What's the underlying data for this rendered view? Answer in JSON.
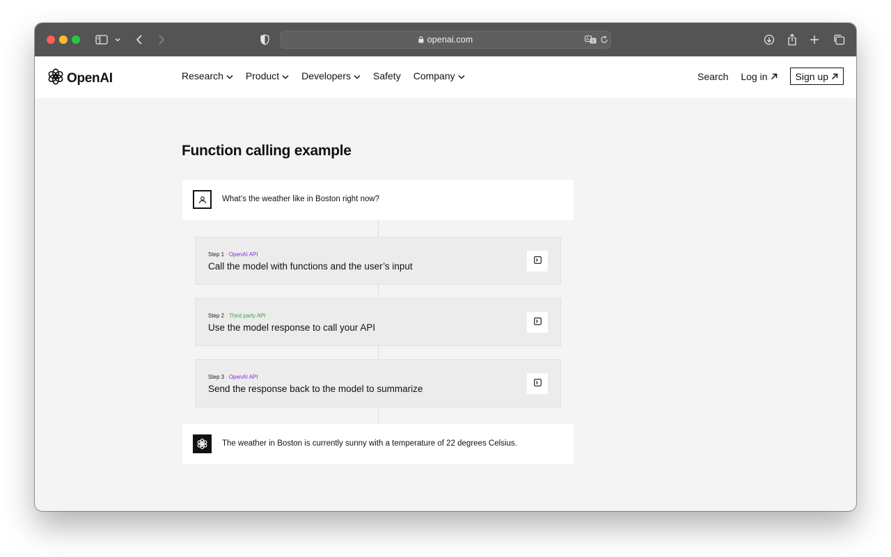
{
  "browser": {
    "url": "openai.com"
  },
  "header": {
    "logo_text": "OpenAI",
    "nav": [
      {
        "label": "Research",
        "has_dropdown": true
      },
      {
        "label": "Product",
        "has_dropdown": true
      },
      {
        "label": "Developers",
        "has_dropdown": true
      },
      {
        "label": "Safety",
        "has_dropdown": false
      },
      {
        "label": "Company",
        "has_dropdown": true
      }
    ],
    "search_label": "Search",
    "login_label": "Log in",
    "signup_label": "Sign up"
  },
  "main": {
    "title": "Function calling example",
    "user_message": "What’s the weather like in Boston right now?",
    "steps": [
      {
        "step_label": "Step 1",
        "api_label": "OpenAI API",
        "api_type": "openai",
        "title": "Call the model with functions and the user’s input"
      },
      {
        "step_label": "Step 2",
        "api_label": "Third party API",
        "api_type": "third",
        "title": "Use the model response to call your API"
      },
      {
        "step_label": "Step 3",
        "api_label": "OpenAI API",
        "api_type": "openai",
        "title": "Send the response back to the model to summarize"
      }
    ],
    "assistant_message": "The weather in Boston is currently sunny with a temperature of 22 degrees Celsius."
  },
  "colors": {
    "openai_api": "#8a2be2",
    "third_party_api": "#3aa53a",
    "toolbar": "#545454",
    "page_bg": "#f4f4f4"
  },
  "icons": {
    "toolbar": [
      "sidebar-icon",
      "chevron-down-icon",
      "back-icon",
      "forward-icon",
      "shield-icon",
      "lock-icon",
      "translate-icon",
      "reload-icon",
      "download-icon",
      "share-icon",
      "new-tab-icon",
      "tabs-overview-icon"
    ],
    "page": [
      "openai-logo-icon",
      "user-icon",
      "terminal-icon",
      "openai-bot-icon",
      "arrow-up-right-icon"
    ]
  }
}
